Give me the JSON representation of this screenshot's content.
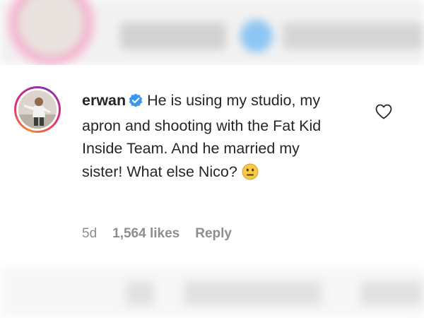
{
  "comment": {
    "username": "erwan",
    "verified": true,
    "text": "He is using my studio, my apron and shooting with the Fat Kid Inside Team. And he married my sister! What else Nico?",
    "emoji": "neutral-face-emoji",
    "time": "5d",
    "likes": "1,564 likes",
    "reply_label": "Reply"
  },
  "icons": {
    "like": "heart-outline-icon",
    "verified": "verified-badge-icon"
  },
  "colors": {
    "text": "#262626",
    "meta": "#8e8e8e",
    "verified_blue": "#3897f0",
    "story_ring": "#dd2a7b"
  }
}
